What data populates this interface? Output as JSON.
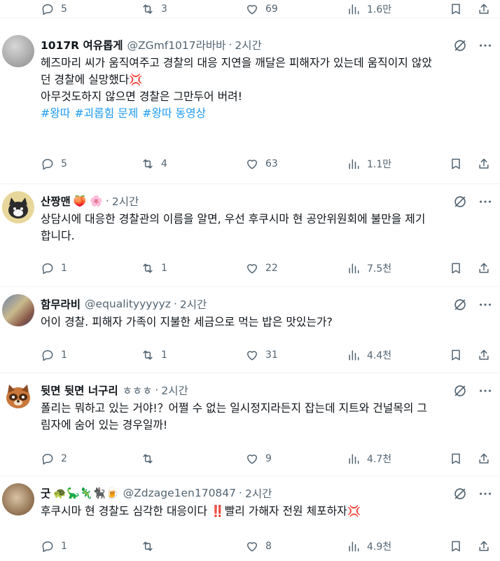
{
  "top_actions": {
    "reply": "5",
    "retweet": "3",
    "like": "69",
    "views": "1.6만"
  },
  "posts": [
    {
      "name": "1017R 여유롭게",
      "name_emoji": "",
      "handle": "@ZGmf1017라바바",
      "time": "2시간",
      "lines": [
        "헤즈마리 씨가 움직여주고 경찰의 대응 지연을 깨달은 피해자가 있는데 움직이지 않았",
        "던 경찰에 실망했다💢",
        "아무것도하지 않으면 경찰은 그만두어 버려!"
      ],
      "hashtags": [
        "#왕따",
        "#괴롭힘 문제",
        "#왕따 동영상"
      ],
      "reply": "5",
      "retweet": "4",
      "like": "63",
      "views": "1.1만"
    },
    {
      "name": "산짱맨",
      "name_emoji": "🍑 🌸",
      "handle": "",
      "time": "2시간",
      "lines": [
        "상담시에 대응한 경찰관의 이름을 알면, 우선 후쿠시마 현 공안위원회에 불만을 제기",
        "합니다."
      ],
      "hashtags": [],
      "reply": "1",
      "retweet": "1",
      "like": "22",
      "views": "7.5천"
    },
    {
      "name": "함무라비",
      "name_emoji": "",
      "handle": "@equalityyyyyz",
      "time": "2시간",
      "lines": [
        "어이 경찰. 피해자 가족이 지불한 세금으로 먹는 밥은 맛있는가?"
      ],
      "hashtags": [],
      "reply": "1",
      "retweet": "1",
      "like": "31",
      "views": "4.4천"
    },
    {
      "name": "뒷면 뒷면 너구리",
      "name_emoji": "",
      "handle": "ㅎㅎㅎ",
      "time": "2시간",
      "lines": [
        "폴리는 뭐하고 있는 거야!？어쩔 수 없는 일시정지라든지 잡는데 지트와 건널목의 그",
        "림자에 숨어 있는 경우일까!"
      ],
      "hashtags": [],
      "reply": "2",
      "retweet": "",
      "like": "9",
      "views": "4.7천"
    },
    {
      "name": "굿",
      "name_emoji": "🐢🦕🦎🐈‍⬛🍺",
      "handle": "@Zdzage1en170847",
      "time": "2시간",
      "lines": [
        "후쿠시마 현 경찰도 심각한 대응이다 ‼️빨리 가해자 전원 체포하자💢"
      ],
      "hashtags": [],
      "reply": "1",
      "retweet": "",
      "like": "8",
      "views": "4.9천"
    }
  ]
}
